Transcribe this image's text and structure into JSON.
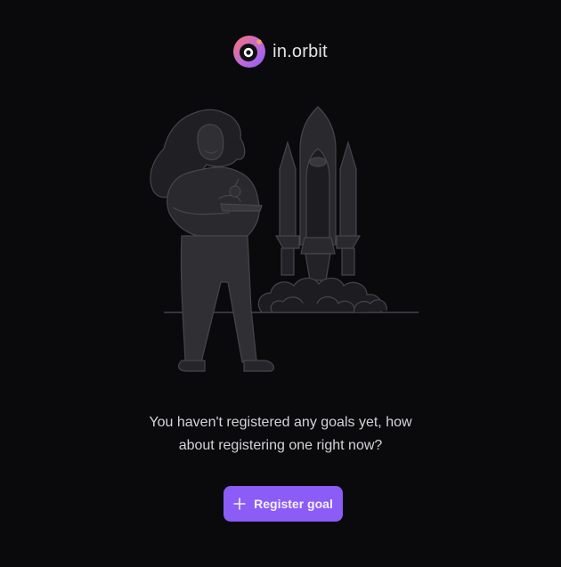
{
  "brand": {
    "name": "in.orbit",
    "logo_icon": "orbit-logo-icon"
  },
  "colors": {
    "background": "#0a0a0d",
    "accent": "#8b5cf6",
    "illustration_fill": "#2a2a2e",
    "illustration_stroke": "#45454c",
    "logo_gradient_start": "#f97373",
    "logo_gradient_end": "#8b5cf6"
  },
  "empty_state": {
    "illustration": "woman-and-rocket-launch-illustration",
    "message_line1": "You haven't registered any goals yet, how",
    "message_line2": "about registering one right now?"
  },
  "actions": {
    "register_goal_label": "Register goal",
    "register_goal_icon": "plus-icon"
  }
}
